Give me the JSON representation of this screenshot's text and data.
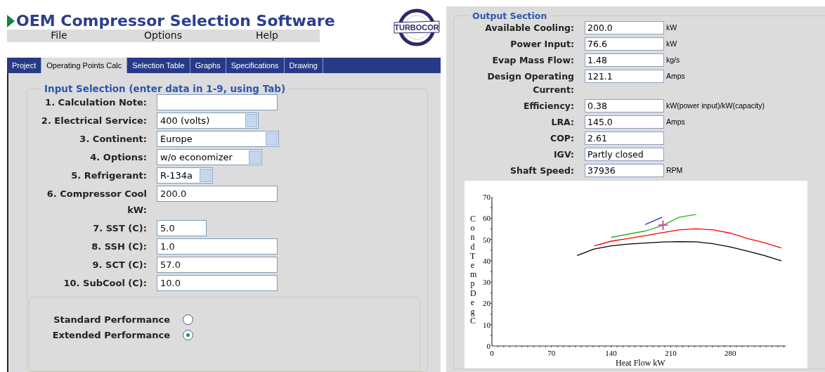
{
  "title": "OEM Compressor Selection Software",
  "menu": [
    "File",
    "Options",
    "Help"
  ],
  "logo": {
    "text": "TURBOCOR"
  },
  "tabs": [
    {
      "label": "Project",
      "selected": false
    },
    {
      "label": "Operating Points Calc",
      "selected": true
    },
    {
      "label": "Selection Table",
      "selected": false
    },
    {
      "label": "Graphs",
      "selected": false
    },
    {
      "label": "Specifications",
      "selected": false
    },
    {
      "label": "Drawing",
      "selected": false
    }
  ],
  "input_section": {
    "legend": "Input Selection (enter data in 1-9, using Tab)",
    "fields": [
      {
        "label": "1. Calculation Note:",
        "kind": "text"
      },
      {
        "label": "2. Electrical Service:",
        "kind": "select",
        "value": "400 (volts)"
      },
      {
        "label": "3. Continent:",
        "kind": "select",
        "value": "Europe"
      },
      {
        "label": "4. Options:",
        "kind": "select",
        "value": "w/o economizer"
      },
      {
        "label": "5. Refrigerant:",
        "kind": "select",
        "value": "R-134a"
      },
      {
        "label": "6. Compressor Cool kW:",
        "kind": "text",
        "value": "200.0"
      },
      {
        "label": "7. SST (C):",
        "kind": "text",
        "value": "5.0"
      },
      {
        "label": "8. SSH (C):",
        "kind": "text",
        "value": "1.0"
      },
      {
        "label": "9. SCT (C):",
        "kind": "text",
        "value": "57.0"
      },
      {
        "label": "10. SubCool (C):",
        "kind": "text",
        "value": "10.0"
      }
    ],
    "performance": [
      {
        "label": "Standard Performance",
        "selected": false
      },
      {
        "label": "Extended Performance",
        "selected": true
      }
    ]
  },
  "output_section": {
    "legend": "Output Section",
    "fields": [
      {
        "label": "Available Cooling:",
        "value": "200.0",
        "unit": "kW"
      },
      {
        "label": "Power Input:",
        "value": "76.6",
        "unit": "kW"
      },
      {
        "label": "Evap Mass Flow:",
        "value": "1.48",
        "unit": "kg/s"
      },
      {
        "label": "Design Operating Current:",
        "value": "121.1",
        "unit": "Amps"
      },
      {
        "label": "Efficiency:",
        "value": "0.38",
        "unit": "kW(power input)/kW(capacity)"
      },
      {
        "label": "LRA:",
        "value": "145.0",
        "unit": "Amps"
      },
      {
        "label": "COP:",
        "value": "2.61"
      },
      {
        "label": "IGV:",
        "value": "Partly closed"
      },
      {
        "label": "Shaft Speed:",
        "value": "37936",
        "unit": "RPM"
      }
    ],
    "chart_data": {
      "type": "line",
      "xlabel": "Heat  Flow  kW",
      "ylabel": "Cond Temp Deg C",
      "x": [
        100,
        120,
        140,
        160,
        180,
        200,
        220,
        240,
        260,
        280,
        300,
        320,
        340
      ],
      "series": [
        {
          "color": "#000000",
          "values": [
            42.5,
            45.5,
            47,
            47.8,
            48.3,
            48.8,
            49,
            48.9,
            48,
            46.5,
            44.5,
            42.5,
            40
          ]
        },
        {
          "color": "#ff0000",
          "values": [
            null,
            47,
            49.2,
            50.5,
            51.8,
            53.2,
            54.5,
            55,
            54.5,
            53,
            50.5,
            48.5,
            46
          ]
        },
        {
          "color": "#33aa22",
          "values": [
            null,
            null,
            51,
            52.5,
            54,
            56.5,
            60.5,
            61.8,
            null,
            null,
            null,
            null,
            null
          ]
        },
        {
          "color": "#2233cc",
          "values": [
            null,
            null,
            null,
            null,
            57,
            60.5,
            null,
            null,
            null,
            null,
            null,
            null,
            null
          ]
        }
      ],
      "xlim": [
        0,
        345
      ],
      "ylim": [
        0,
        70
      ],
      "xticks": [
        0,
        70,
        140,
        210,
        280
      ],
      "yticks": [
        0,
        10,
        20,
        30,
        40,
        50,
        60,
        70
      ],
      "annotations": [
        {
          "x": 201,
          "y": 57,
          "text": "+"
        }
      ]
    }
  }
}
